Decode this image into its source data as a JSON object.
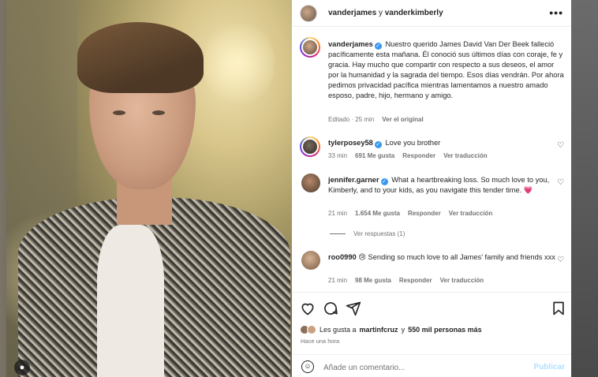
{
  "header": {
    "user1": "vanderjames",
    "join": "y",
    "user2": "vanderkimberly",
    "more_icon": "more-horizontal-icon"
  },
  "caption": {
    "username": "vanderjames",
    "text": "Nuestro querido James David Van Der Beek falleció pacíficamente esta mañana. Él conoció sus últimos días con coraje, fe y gracia. Hay mucho que compartir con respecto a sus deseos, el amor por la humanidad y la sagrada del tiempo. Esos días vendrán. Por ahora pedimos privacidad pacífica mientras lamentamos a nuestro amado esposo, padre, hijo, hermano y amigo.",
    "edited": "Editado · 25 min",
    "see_original": "Ver el original"
  },
  "comments": [
    {
      "user": "tylerposey58",
      "verified": true,
      "text": "Love you brother",
      "time": "33 min",
      "likes": "691 Me gusta",
      "reply": "Responder",
      "translate": "Ver traducción"
    },
    {
      "user": "jennifer.garner",
      "verified": true,
      "text": "What a heartbreaking loss. So much love to you, Kimberly, and to your kids, as you navigate this tender time. 💗",
      "time": "21 min",
      "likes": "1.654 Me gusta",
      "reply": "Responder",
      "translate": "Ver traducción"
    },
    {
      "user": "roo0990",
      "verified": false,
      "text": "😢 Sending so much love to all James' family and friends xxx",
      "time": "21 min",
      "likes": "98 Me gusta",
      "reply": "Responder",
      "translate": "Ver traducción"
    }
  ],
  "view_replies": "Ver respuestas (1)",
  "likes_summary": {
    "prefix": "Les gusta a",
    "user": "martinfcruz",
    "suffix": "y",
    "count": "550 mil personas más"
  },
  "post_time": "Hace una hora",
  "comment_box": {
    "placeholder": "Añade un comentario...",
    "publish": "Publicar"
  },
  "colors": {
    "verified": "#3897f0",
    "publish": "#b2dffc",
    "text": "#262626",
    "muted": "#737373"
  }
}
